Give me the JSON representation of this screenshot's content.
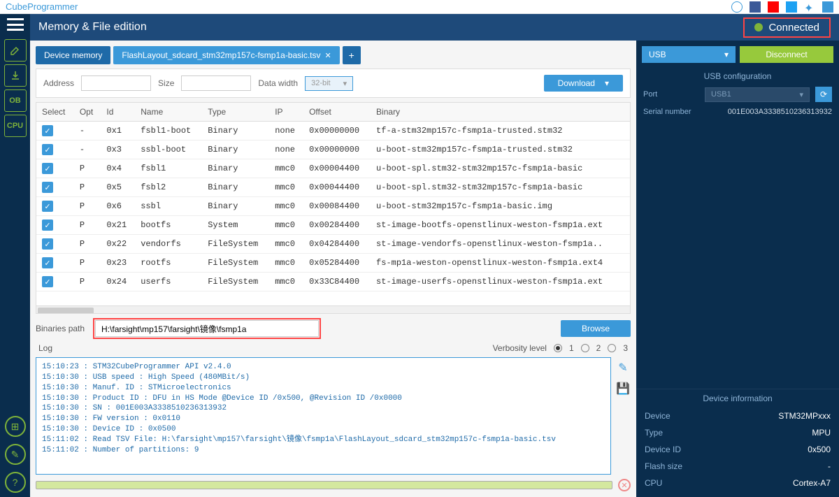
{
  "app": {
    "title": "CubeProgrammer"
  },
  "header": {
    "title": "Memory & File edition",
    "connected": "Connected"
  },
  "rail": {
    "ob": "OB",
    "cpu": "CPU"
  },
  "tabs": {
    "main": "Device memory",
    "sub": "FlashLayout_sdcard_stm32mp157c-fsmp1a-basic.tsv"
  },
  "params": {
    "address_label": "Address",
    "size_label": "Size",
    "datawidth_label": "Data width",
    "datawidth_value": "32-bit",
    "download": "Download"
  },
  "table": {
    "headers": [
      "Select",
      "Opt",
      "Id",
      "Name",
      "Type",
      "IP",
      "Offset",
      "Binary"
    ],
    "rows": [
      {
        "opt": "-",
        "id": "0x1",
        "name": "fsbl1-boot",
        "type": "Binary",
        "ip": "none",
        "offset": "0x00000000",
        "binary": "tf-a-stm32mp157c-fsmp1a-trusted.stm32"
      },
      {
        "opt": "-",
        "id": "0x3",
        "name": "ssbl-boot",
        "type": "Binary",
        "ip": "none",
        "offset": "0x00000000",
        "binary": "u-boot-stm32mp157c-fsmp1a-trusted.stm32"
      },
      {
        "opt": "P",
        "id": "0x4",
        "name": "fsbl1",
        "type": "Binary",
        "ip": "mmc0",
        "offset": "0x00004400",
        "binary": "u-boot-spl.stm32-stm32mp157c-fsmp1a-basic"
      },
      {
        "opt": "P",
        "id": "0x5",
        "name": "fsbl2",
        "type": "Binary",
        "ip": "mmc0",
        "offset": "0x00044400",
        "binary": "u-boot-spl.stm32-stm32mp157c-fsmp1a-basic"
      },
      {
        "opt": "P",
        "id": "0x6",
        "name": "ssbl",
        "type": "Binary",
        "ip": "mmc0",
        "offset": "0x00084400",
        "binary": "u-boot-stm32mp157c-fsmp1a-basic.img"
      },
      {
        "opt": "P",
        "id": "0x21",
        "name": "bootfs",
        "type": "System",
        "ip": "mmc0",
        "offset": "0x00284400",
        "binary": "st-image-bootfs-openstlinux-weston-fsmp1a.ext"
      },
      {
        "opt": "P",
        "id": "0x22",
        "name": "vendorfs",
        "type": "FileSystem",
        "ip": "mmc0",
        "offset": "0x04284400",
        "binary": "st-image-vendorfs-openstlinux-weston-fsmp1a.."
      },
      {
        "opt": "P",
        "id": "0x23",
        "name": "rootfs",
        "type": "FileSystem",
        "ip": "mmc0",
        "offset": "0x05284400",
        "binary": "fs-mp1a-weston-openstlinux-weston-fsmp1a.ext4"
      },
      {
        "opt": "P",
        "id": "0x24",
        "name": "userfs",
        "type": "FileSystem",
        "ip": "mmc0",
        "offset": "0x33C84400",
        "binary": "st-image-userfs-openstlinux-weston-fsmp1a.ext"
      }
    ]
  },
  "binpath": {
    "label": "Binaries path",
    "value": "H:\\farsight\\mp157\\farsight\\镜像\\fsmp1a",
    "browse": "Browse"
  },
  "log": {
    "label": "Log",
    "verbosity_label": "Verbosity level",
    "levels": [
      "1",
      "2",
      "3"
    ],
    "text": "15:10:23 : STM32CubeProgrammer API v2.4.0\n15:10:30 : USB speed : High Speed (480MBit/s)\n15:10:30 : Manuf. ID : STMicroelectronics\n15:10:30 : Product ID : DFU in HS Mode @Device ID /0x500, @Revision ID /0x0000\n15:10:30 : SN : 001E003A3338510236313932\n15:10:30 : FW version : 0x0110\n15:10:30 : Device ID : 0x0500\n15:11:02 : Read TSV File: H:\\farsight\\mp157\\farsight\\镜像\\fsmp1a\\FlashLayout_sdcard_stm32mp157c-fsmp1a-basic.tsv\n15:11:02 : Number of partitions: 9"
  },
  "right": {
    "usb": "USB",
    "disconnect": "Disconnect",
    "config_title": "USB configuration",
    "port_label": "Port",
    "port_value": "USB1",
    "serial_label": "Serial number",
    "serial_value": "001E003A3338510236313932",
    "devinfo_title": "Device information",
    "info": [
      {
        "k": "Device",
        "v": "STM32MPxxx"
      },
      {
        "k": "Type",
        "v": "MPU"
      },
      {
        "k": "Device ID",
        "v": "0x500"
      },
      {
        "k": "Flash size",
        "v": "-"
      },
      {
        "k": "CPU",
        "v": "Cortex-A7"
      }
    ]
  }
}
